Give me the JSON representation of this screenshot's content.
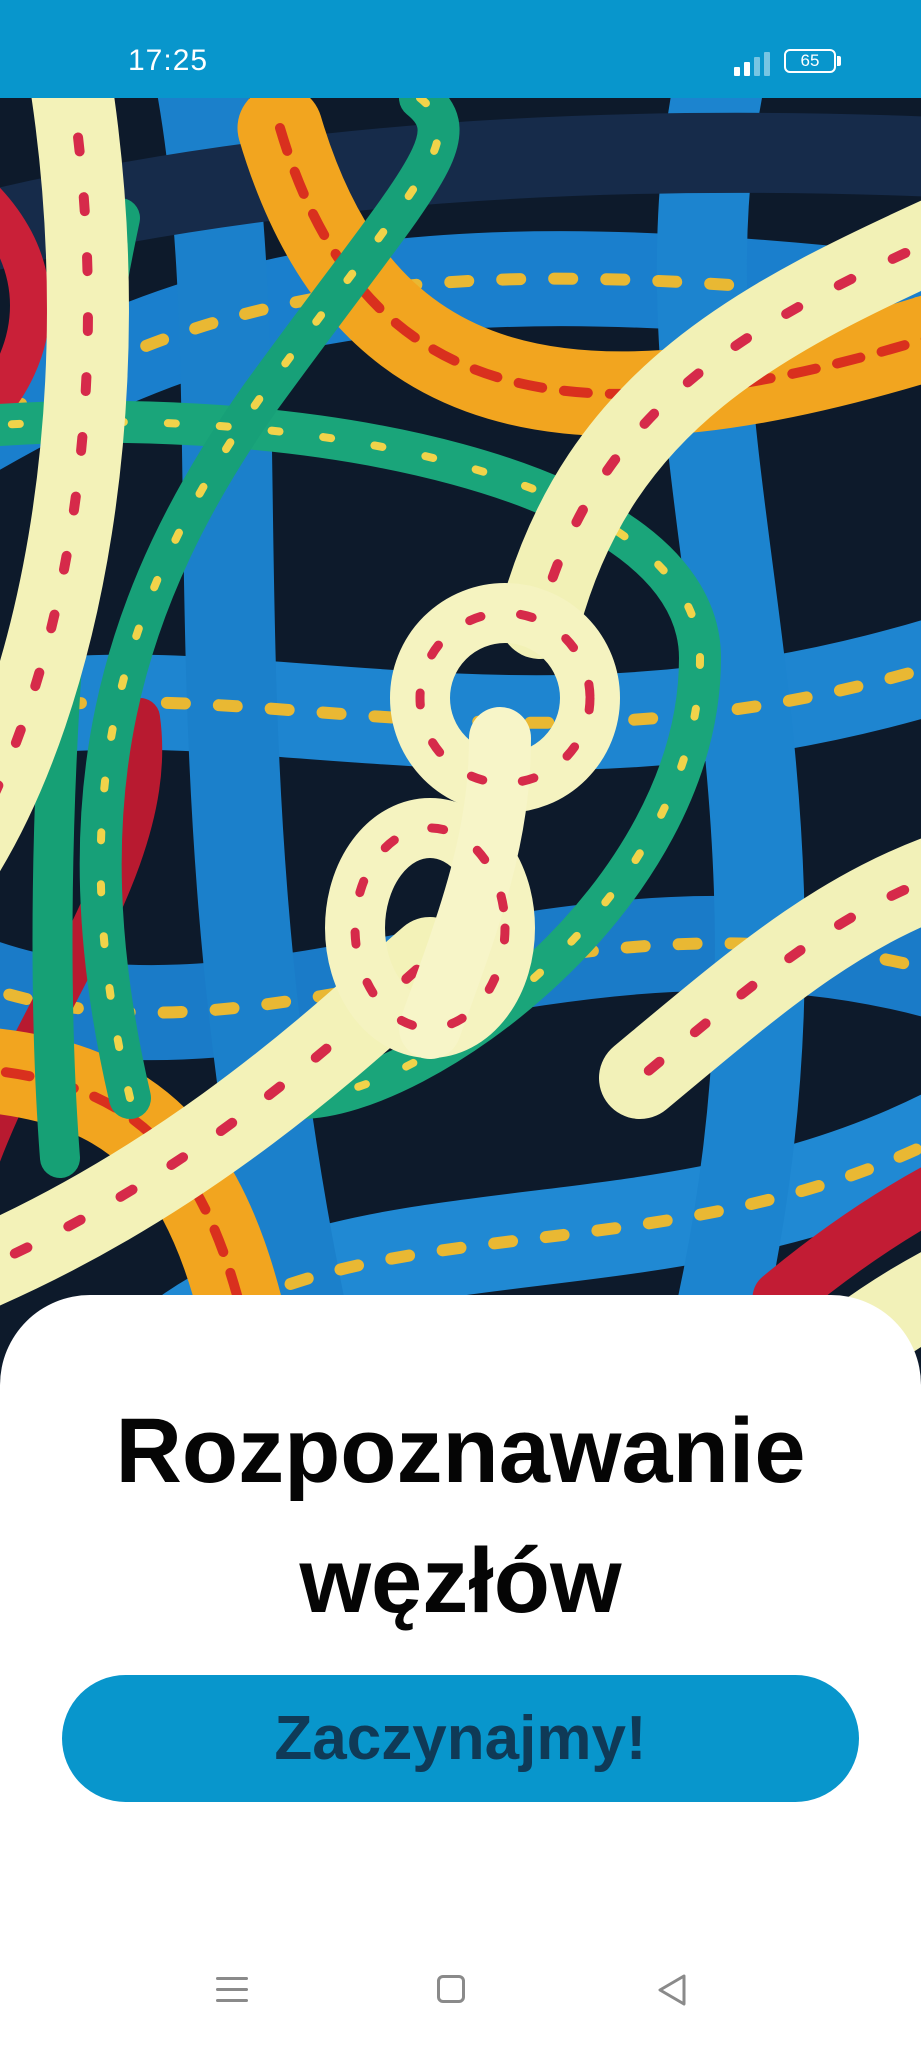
{
  "status_bar": {
    "time": "17:25",
    "battery": "65",
    "background_color": "#0896cc",
    "signal_bars_active": 2,
    "signal_bars_total": 4
  },
  "hero": {
    "image": "colorful-climbing-ropes-with-knot-photo"
  },
  "card": {
    "title_line1": "Rozpoznawanie",
    "title_line2": "węzłów",
    "start_button_label": "Zaczynajmy!",
    "button_color": "#0896cc",
    "button_text_color": "#0f3a57"
  },
  "nav_bar": {
    "icons": [
      "menu-icon",
      "home-icon",
      "back-icon"
    ]
  }
}
